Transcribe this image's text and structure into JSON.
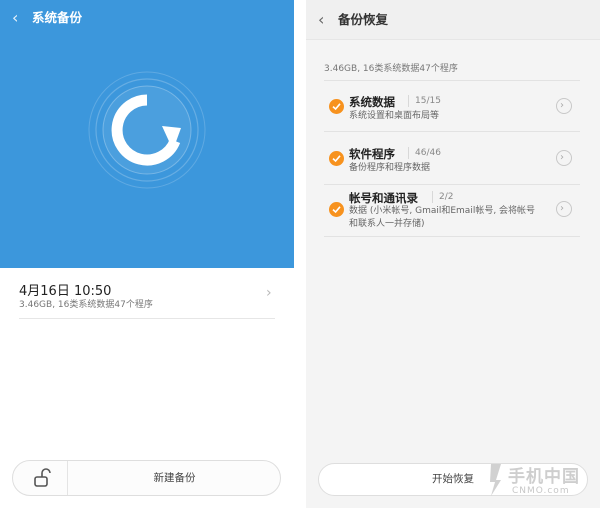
{
  "left_screen": {
    "header": {
      "back_icon": "chevron-left-icon",
      "title": "系统备份"
    },
    "hero_icon": "backup-restore-logo-icon",
    "colors": {
      "header_blue": "#3c97dc"
    },
    "latest_backup": {
      "time": "4月16日 10:50",
      "info": "3.46GB, 16类系统数据47个程序"
    },
    "bottom_bar": {
      "lock_icon": "unlock-icon",
      "new_backup_label": "新建备份"
    }
  },
  "right_screen": {
    "header": {
      "back_icon": "chevron-left-icon",
      "title": "备份恢复"
    },
    "summary": "3.46GB, 16类系统数据47个程序",
    "items": [
      {
        "name": "系统数据",
        "count": "15/15",
        "description": "系统设置和桌面布局等",
        "checked": true
      },
      {
        "name": "软件程序",
        "count": "46/46",
        "description": "备份程序和程序数据",
        "checked": true
      },
      {
        "name": "帐号和通讯录",
        "count": "2/2",
        "description": "数据 (小米帐号, Gmail和Email帐号, 会将帐号和联系人一并存储)",
        "checked": true
      }
    ],
    "restore_button_label": "开始恢复",
    "colors": {
      "check_orange": "#f7921e"
    }
  },
  "watermark": {
    "brand": "手机中国",
    "url": "CNMO.com"
  }
}
